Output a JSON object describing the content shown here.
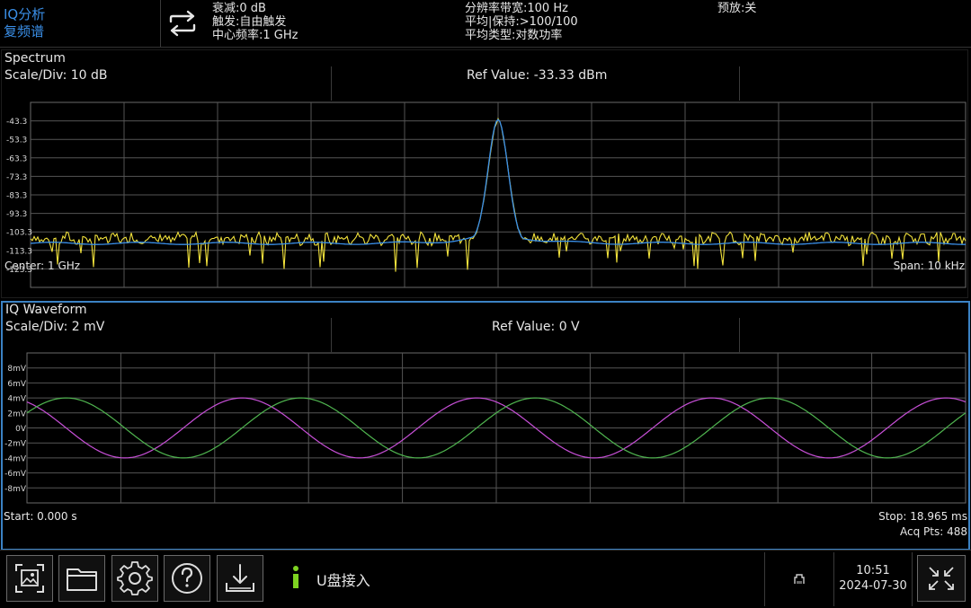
{
  "header": {
    "mode_line1": "IQ分析",
    "mode_line2": "复频谱",
    "col1": [
      "衰减:0 dB",
      "触发:自由触发",
      "中心频率:1 GHz"
    ],
    "col2": [
      "分辨率带宽:100 Hz",
      "平均|保持:>100/100",
      "平均类型:对数功率"
    ],
    "preamp": "预放:关",
    "colors": {
      "accent": "#3a8ee6"
    }
  },
  "spectrum": {
    "title": "Spectrum",
    "scale_div": "Scale/Div: 10 dB",
    "ref_value": "Ref Value: -33.33 dBm",
    "y_ticks": [
      "-43.3",
      "-53.3",
      "-63.3",
      "-73.3",
      "-83.3",
      "-93.3",
      "-103.3",
      "-113.3",
      "-123.3"
    ],
    "center": "Center: 1 GHz",
    "span": "Span: 10 kHz",
    "colors": {
      "trace_avg": "#3a8fe8",
      "trace_live": "#f2e23c",
      "grid": "#6a6a6a"
    }
  },
  "iq_waveform": {
    "title": "IQ Waveform",
    "scale_div": "Scale/Div: 2 mV",
    "ref_value": "Ref Value: 0 V",
    "y_ticks": [
      "8mV",
      "6mV",
      "4mV",
      "2mV",
      "0V",
      "-2mV",
      "-4mV",
      "-6mV",
      "-8mV"
    ],
    "start": "Start: 0.000 s",
    "stop": "Stop: 18.965 ms",
    "acq_pts": "Acq Pts: 488",
    "colors": {
      "i_trace": "#c64fd6",
      "q_trace": "#4fb44f",
      "border": "#3b82c4"
    }
  },
  "chart_data": [
    {
      "type": "line",
      "title": "Spectrum",
      "ylabel": "",
      "xlabel": "",
      "x_range_label": [
        "Center: 1 GHz",
        "Span: 10 kHz"
      ],
      "ylim": [
        -133.3,
        -33.3
      ],
      "grid": true,
      "series": [
        {
          "peak_x_fraction": 0.5,
          "peak_value_dBm": -43.0,
          "noise_floor_dBm": -109.5,
          "trace": "average"
        },
        {
          "peak_x_fraction": 0.5,
          "peak_value_dBm": -43.0,
          "noise_floor_dBm": -107.0,
          "trace": "live"
        }
      ]
    },
    {
      "type": "line",
      "title": "IQ Waveform",
      "ylim": [
        -10,
        10
      ],
      "y_unit": "mV",
      "x_range": [
        0,
        18.965
      ],
      "x_unit": "ms",
      "grid": true,
      "series": [
        {
          "amplitude_mV": 4.0,
          "cycles": 4.0,
          "phase_deg": 120,
          "trace": "I"
        },
        {
          "amplitude_mV": 4.0,
          "cycles": 4.0,
          "phase_deg": 30,
          "trace": "Q"
        }
      ]
    }
  ],
  "toolbar": {
    "buttons": [
      "screenshot-icon",
      "folder-icon",
      "gear-icon",
      "help-icon",
      "download-icon"
    ],
    "message": "U盘接入",
    "time": "10:51",
    "date": "2024-07-30"
  }
}
